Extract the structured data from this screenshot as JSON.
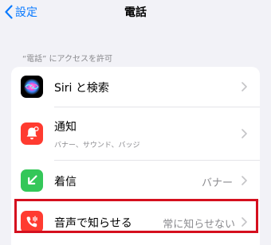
{
  "nav": {
    "back_label": "設定",
    "title": "電話"
  },
  "section": {
    "header": "“電話” にアクセスを許可"
  },
  "rows": [
    {
      "label": "Siri と検索",
      "icon": "siri-icon"
    },
    {
      "label": "通知",
      "subtitle": "バナー、サウンド、バッジ",
      "icon": "bell-icon"
    },
    {
      "label": "着信",
      "value": "バナー",
      "icon": "incoming-call-icon"
    },
    {
      "label": "音声で知らせる",
      "value": "常に知らせない",
      "icon": "announce-call-icon"
    }
  ],
  "colors": {
    "accent": "#0a7aff",
    "notifications_icon": "#ff3b30",
    "incoming_icon": "#34c759",
    "announce_icon": "#ff3b30",
    "highlight_border": "#d50f1e"
  }
}
